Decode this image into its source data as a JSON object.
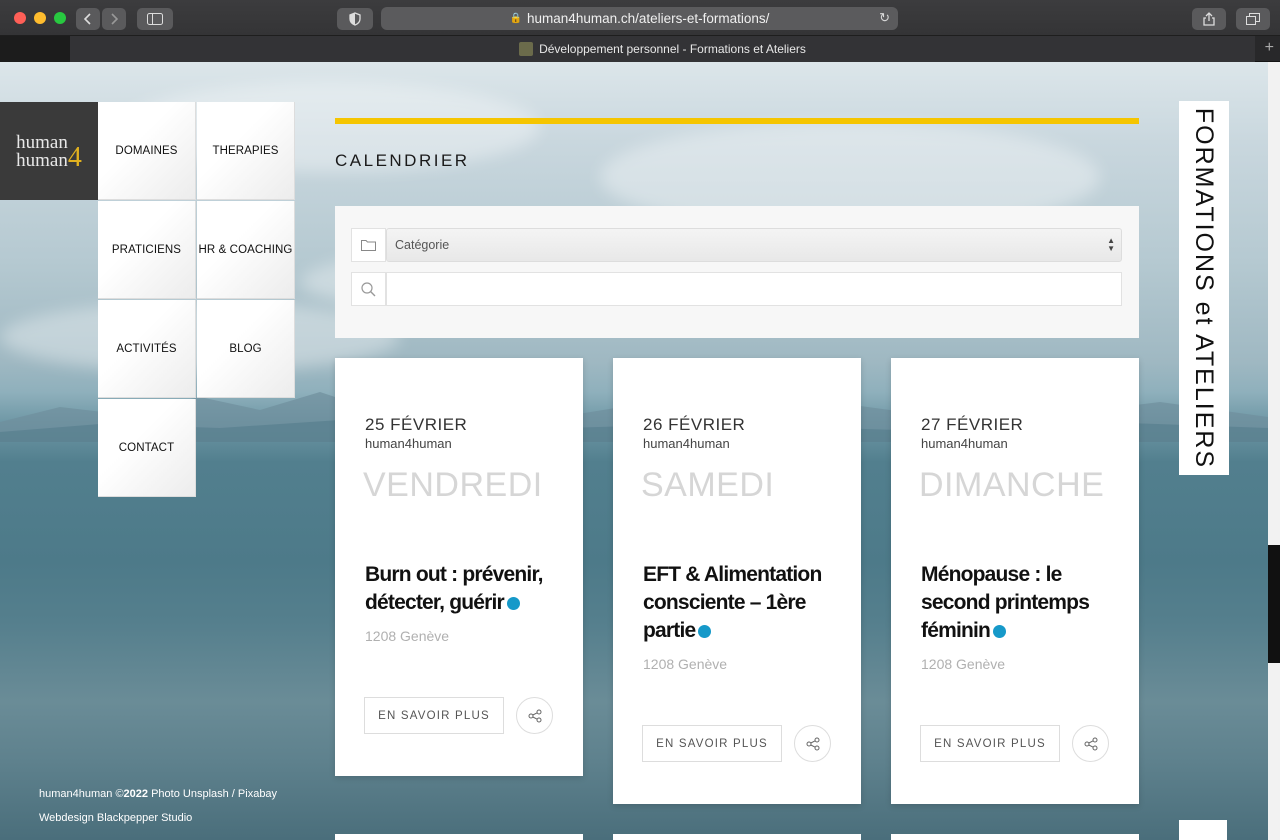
{
  "browser": {
    "url": "human4human.ch/ateliers-et-formations/",
    "tab_title": "Développement personnel - Formations et Ateliers"
  },
  "logo": {
    "line1": "human",
    "line2": "human",
    "mark": "4"
  },
  "nav": {
    "domaines": "DOMAINES",
    "therapies": "THERAPIES",
    "praticiens": "PRATICIENS",
    "hr_coaching": "HR & COACHING",
    "activites": "ACTIVITÉS",
    "blog": "BLOG",
    "contact": "CONTACT"
  },
  "footer": {
    "brand": "human4human ©",
    "year": "2022",
    "photo": " Photo Unsplash / Pixabay",
    "webdesign": "Webdesign Blackpepper Studio"
  },
  "calendar": {
    "heading": "CALENDRIER",
    "category_placeholder": "Catégorie",
    "search_value": ""
  },
  "side_title": "FORMATIONS et ATELIERS",
  "events": [
    {
      "date": "25 FÉVRIER",
      "organizer": "human4human",
      "weekday": "VENDREDI",
      "title": "Burn out : prévenir, détecter, guérir",
      "location": "1208 Genève",
      "more_label": "EN SAVOIR PLUS"
    },
    {
      "date": "26 FÉVRIER",
      "organizer": "human4human",
      "weekday": "SAMEDI",
      "title": "EFT & Alimentation consciente – 1ère partie",
      "location": "1208 Genève",
      "more_label": "EN SAVOIR PLUS"
    },
    {
      "date": "27 FÉVRIER",
      "organizer": "human4human",
      "weekday": "DIMANCHE",
      "title": "Ménopause : le second printemps féminin",
      "location": "1208 Genève",
      "more_label": "EN SAVOIR PLUS"
    }
  ],
  "colors": {
    "accent_yellow": "#f5c500",
    "dot_blue": "#1699c9"
  },
  "icons": [
    "back-icon",
    "forward-icon",
    "sidebar-icon",
    "shield-icon",
    "lock-icon",
    "reload-icon",
    "share-icon",
    "tabs-icon",
    "folder-icon",
    "search-icon",
    "share-nodes-icon"
  ]
}
